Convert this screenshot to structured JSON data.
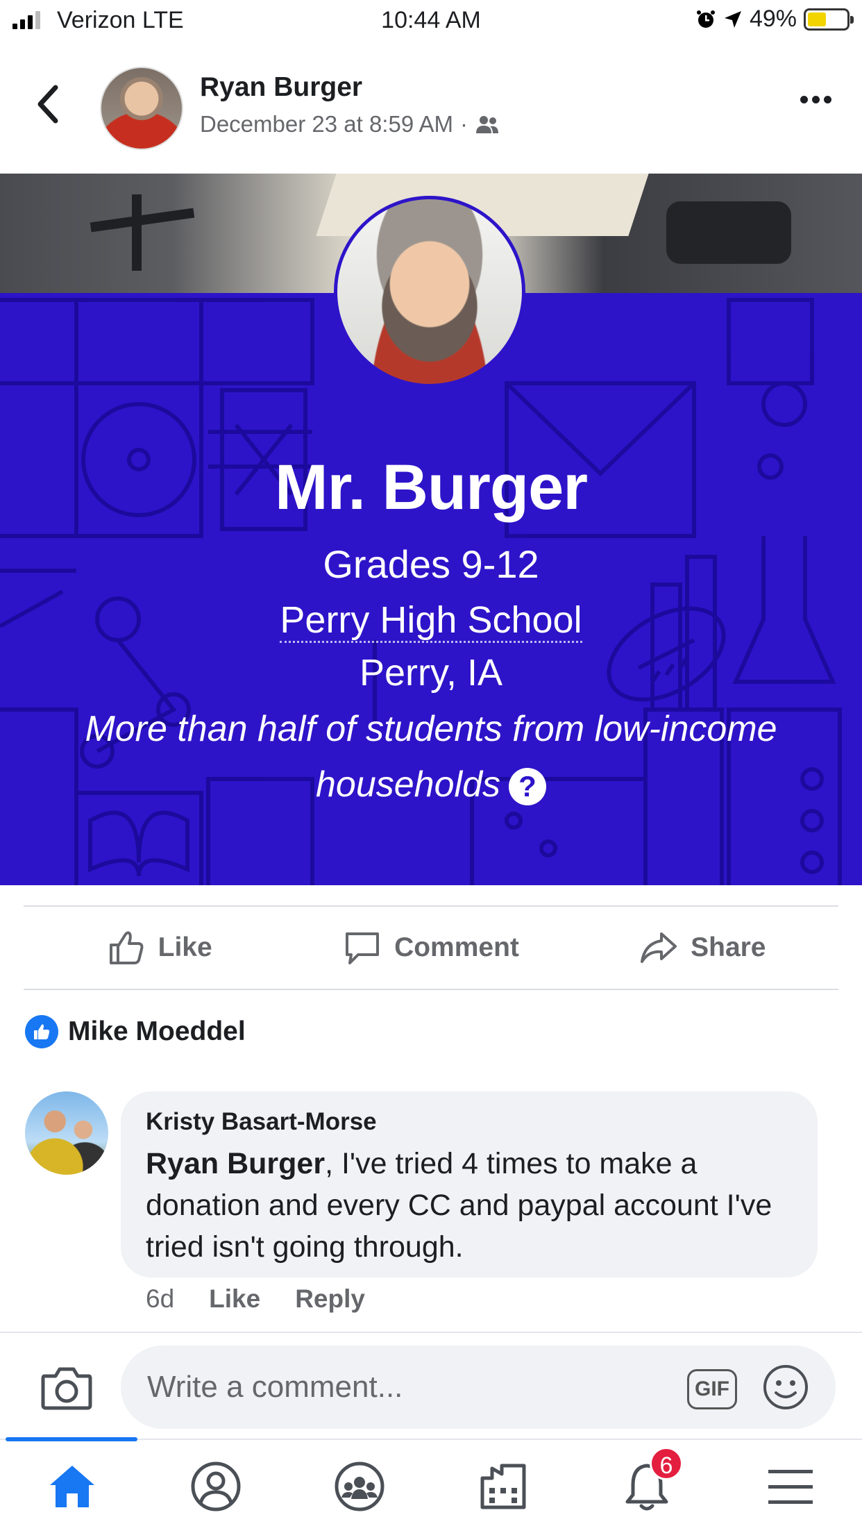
{
  "status_bar": {
    "carrier": "Verizon LTE",
    "time": "10:44 AM",
    "battery": "49%",
    "battery_level": 0.49
  },
  "post": {
    "author": "Ryan Burger",
    "timestamp": "December 23 at 8:59 AM",
    "separator": "·",
    "audience_icon": "friends-icon"
  },
  "card": {
    "name": "Mr. Burger",
    "grades": "Grades 9-12",
    "school": "Perry High School",
    "location": "Perry, IA",
    "note": "More than half of students from low-income households",
    "help_symbol": "?"
  },
  "actions": {
    "like": "Like",
    "comment": "Comment",
    "share": "Share"
  },
  "reactions": {
    "names": "Mike Moeddel"
  },
  "comments": [
    {
      "author": "Kristy Basart-Morse",
      "mention": "Ryan Burger",
      "text": ", I've tried 4 times to make a donation and every CC and paypal account I've tried isn't going through.",
      "age": "6d",
      "like_label": "Like",
      "reply_label": "Reply"
    }
  ],
  "composer": {
    "placeholder": "Write a comment...",
    "gif_label": "GIF"
  },
  "nav": {
    "items": [
      "home-icon",
      "profile-icon",
      "groups-icon",
      "marketplace-icon",
      "notifications-icon",
      "menu-icon"
    ],
    "notifications_badge": "6",
    "active": "home",
    "accent": "#1877f2"
  },
  "colors": {
    "card_background": "#2d14c9",
    "brand_blue": "#1877f2",
    "badge_red": "#e41e3f"
  }
}
